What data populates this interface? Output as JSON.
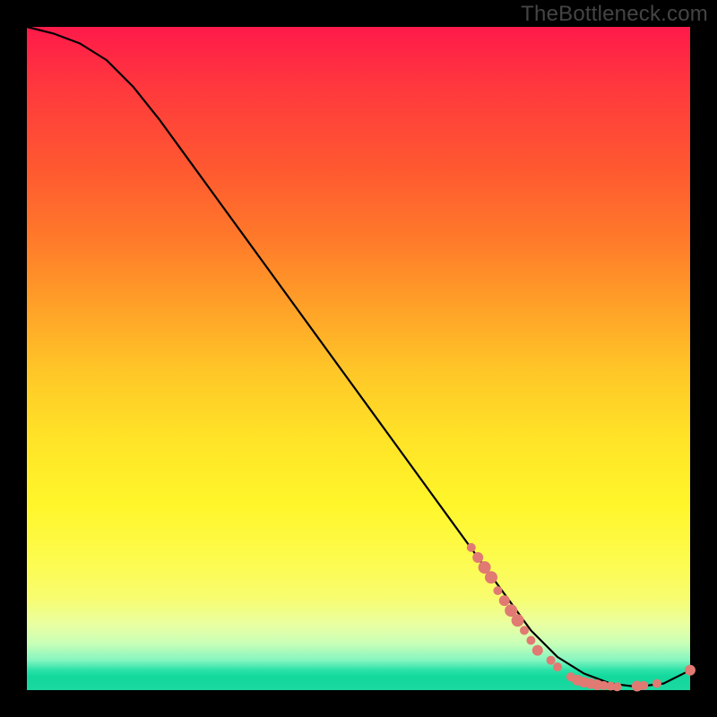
{
  "watermark": "TheBottleneck.com",
  "colors": {
    "background": "#000000",
    "gradient_top": "#ff1a4a",
    "gradient_bottom": "#1bd8a0",
    "curve": "#000000",
    "marker": "#e07a72"
  },
  "chart_data": {
    "type": "line",
    "title": "",
    "xlabel": "",
    "ylabel": "",
    "xlim": [
      0,
      100
    ],
    "ylim": [
      0,
      100
    ],
    "grid": false,
    "legend": false,
    "series": [
      {
        "name": "bottleneck-curve",
        "x": [
          0,
          4,
          8,
          12,
          16,
          20,
          24,
          28,
          32,
          36,
          40,
          44,
          48,
          52,
          56,
          60,
          64,
          68,
          72,
          76,
          80,
          84,
          88,
          92,
          96,
          100
        ],
        "y": [
          100,
          99,
          97.5,
          95,
          91,
          86,
          80.5,
          75,
          69.5,
          64,
          58.5,
          53,
          47.5,
          42,
          36.5,
          31,
          25.5,
          20,
          14.5,
          9,
          5,
          2.5,
          1,
          0.5,
          1,
          3
        ]
      }
    ],
    "markers": [
      {
        "x": 67,
        "y": 21.5,
        "r": 5
      },
      {
        "x": 68,
        "y": 20.0,
        "r": 6
      },
      {
        "x": 69,
        "y": 18.5,
        "r": 7
      },
      {
        "x": 70,
        "y": 17.0,
        "r": 7
      },
      {
        "x": 71,
        "y": 15.0,
        "r": 5
      },
      {
        "x": 72,
        "y": 13.5,
        "r": 6
      },
      {
        "x": 73,
        "y": 12.0,
        "r": 7
      },
      {
        "x": 74,
        "y": 10.5,
        "r": 7
      },
      {
        "x": 75,
        "y": 9.0,
        "r": 5
      },
      {
        "x": 76,
        "y": 7.5,
        "r": 5
      },
      {
        "x": 77,
        "y": 6.0,
        "r": 6
      },
      {
        "x": 79,
        "y": 4.5,
        "r": 5
      },
      {
        "x": 80,
        "y": 3.5,
        "r": 5
      },
      {
        "x": 82,
        "y": 2.0,
        "r": 5
      },
      {
        "x": 83,
        "y": 1.5,
        "r": 6
      },
      {
        "x": 84,
        "y": 1.2,
        "r": 6
      },
      {
        "x": 85,
        "y": 1.0,
        "r": 6
      },
      {
        "x": 86,
        "y": 0.8,
        "r": 6
      },
      {
        "x": 87,
        "y": 0.7,
        "r": 5
      },
      {
        "x": 88,
        "y": 0.6,
        "r": 5
      },
      {
        "x": 89,
        "y": 0.5,
        "r": 5
      },
      {
        "x": 92,
        "y": 0.6,
        "r": 6
      },
      {
        "x": 93,
        "y": 0.7,
        "r": 5
      },
      {
        "x": 95,
        "y": 1.0,
        "r": 5
      },
      {
        "x": 100,
        "y": 3.0,
        "r": 6
      }
    ]
  }
}
